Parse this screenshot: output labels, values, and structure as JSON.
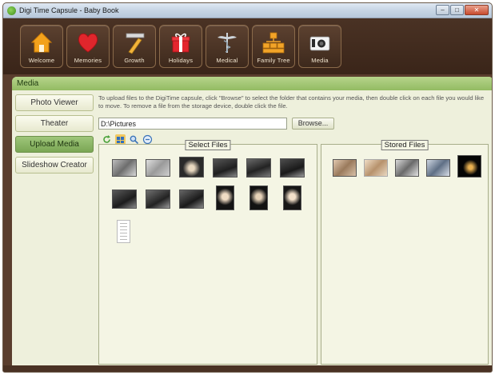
{
  "window": {
    "title": "Digi Time Capsule - Baby Book",
    "min_symbol": "–",
    "max_symbol": "□",
    "close_symbol": "✕"
  },
  "nav": [
    {
      "label": "Welcome",
      "icon": "house-icon"
    },
    {
      "label": "Memories",
      "icon": "heart-icon"
    },
    {
      "label": "Growth",
      "icon": "ruler-pencil-icon"
    },
    {
      "label": "Holidays",
      "icon": "gift-icon"
    },
    {
      "label": "Medical",
      "icon": "caduceus-icon"
    },
    {
      "label": "Family Tree",
      "icon": "family-tree-icon"
    },
    {
      "label": "Media",
      "icon": "camera-icon"
    }
  ],
  "section": {
    "title": "Media"
  },
  "sidebar": [
    {
      "label": "Photo Viewer"
    },
    {
      "label": "Theater"
    },
    {
      "label": "Upload Media"
    },
    {
      "label": "Slideshow Creator"
    }
  ],
  "upload": {
    "instructions": "To upload files to the DigiTime capsule, click \"Browse\" to select the folder that contains your media, then double click on each file you would like to move. To remove a file from the storage device, double click the file.",
    "path_value": "D:\\Pictures",
    "browse_label": "Browse..."
  },
  "panes": {
    "select_title": "Select Files",
    "stored_title": "Stored Files"
  },
  "colors": {
    "frame": "#5a3e2e",
    "header_green": "#93bb63",
    "active_green": "#7aa654",
    "panel_bg": "#eef0dc"
  }
}
